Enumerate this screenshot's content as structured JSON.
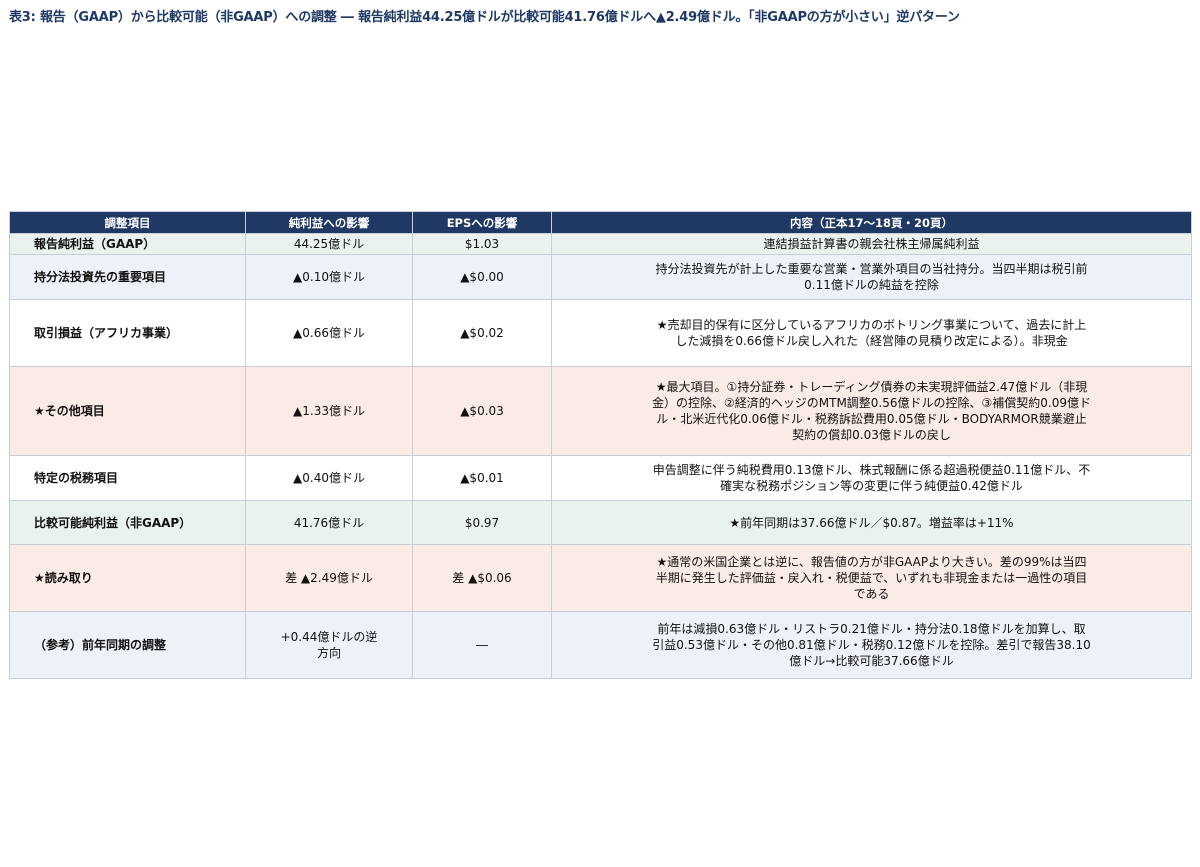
{
  "title": "表3: 報告（GAAP）から比較可能（非GAAP）への調整 ― 報告純利益44.25億ドルが比較可能41.76億ドルへ▲2.49億ドル。「非GAAPの方が小さい」逆パターン",
  "table": {
    "headers": [
      "調整項目",
      "純利益への影響",
      "EPSへの影響",
      "内容（正本17～18頁・20頁）"
    ],
    "rows": [
      {
        "item": "報告純利益（GAAP）",
        "net_income": "44.25億ドル",
        "eps": "$1.03",
        "description": "連結損益計算書の親会社株主帰属純利益"
      },
      {
        "item": "持分法投資先の重要項目",
        "net_income": "▲0.10億ドル",
        "eps": "▲$0.00",
        "description": "持分法投資先が計上した重要な営業・営業外項目の当社持分。当四半期は税引前0.11億ドルの純益を控除"
      },
      {
        "item": "取引損益（アフリカ事業）",
        "net_income": "▲0.66億ドル",
        "eps": "▲$0.02",
        "description": "★売却目的保有に区分しているアフリカのボトリング事業について、過去に計上した減損を0.66億ドル戻し入れた（経営陣の見積り改定による）。非現金"
      },
      {
        "item": "★その他項目",
        "net_income": "▲1.33億ドル",
        "eps": "▲$0.03",
        "description": "★最大項目。①持分証券・トレーディング債券の未実現評価益2.47億ドル（非現金）の控除、②経済的ヘッジのMTM調整0.56億ドルの控除、③補償契約0.09億ドル・北米近代化0.06億ドル・税務訴訟費用0.05億ドル・BODYARMOR競業避止契約の償却0.03億ドルの戻し"
      },
      {
        "item": "特定の税務項目",
        "net_income": "▲0.40億ドル",
        "eps": "▲$0.01",
        "description": "申告調整に伴う純税費用0.13億ドル、株式報酬に係る超過税便益0.11億ドル、不確実な税務ポジション等の変更に伴う純便益0.42億ドル"
      },
      {
        "item": "比較可能純利益（非GAAP）",
        "net_income": "41.76億ドル",
        "eps": "$0.97",
        "description": "★前年同期は37.66億ドル／$0.87。増益率は+11%"
      },
      {
        "item": "★読み取り",
        "net_income": "差 ▲2.49億ドル",
        "eps": "差 ▲$0.06",
        "description": "★通常の米国企業とは逆に、報告値の方が非GAAPより大きい。差の99%は当四半期に発生した評価益・戻入れ・税便益で、いずれも非現金または一過性の項目である"
      },
      {
        "item": "（参考）前年同期の調整",
        "net_income": "+0.44億ドルの逆方向",
        "eps": "―",
        "description": "前年は減損0.63億ドル・リストラ0.21億ドル・持分法0.18億ドルを加算し、取引益0.53億ドル・その他0.81億ドル・税務0.12億ドルを控除。差引で報告38.10億ドル→比較可能37.66億ドル"
      }
    ]
  },
  "colors": {
    "header_bg": "#1f3864",
    "title_text": "#1f3864",
    "row_green": "#e9f2ec",
    "row_blue": "#edf2f8",
    "row_pink": "#fbebe6",
    "row_white": "#ffffff"
  }
}
